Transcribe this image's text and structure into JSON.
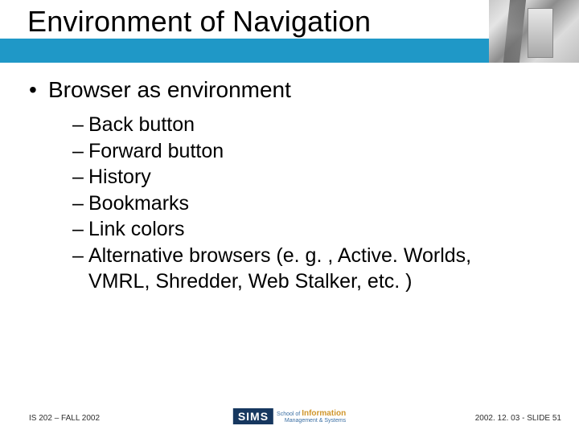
{
  "title": "Environment of Navigation",
  "bullet_main": "Browser as environment",
  "subitems": [
    "Back button",
    "Forward button",
    "History",
    "Bookmarks",
    "Link colors",
    "Alternative browsers (e. g. , Active. Worlds, VMRL, Shredder, Web Stalker, etc. )"
  ],
  "alt_line2": "VMRL, Shredder, Web Stalker, etc. )",
  "alt_line1": "Alternative browsers (e. g. , Active. Worlds,",
  "footer": {
    "left": "IS 202 – FALL 2002",
    "right": "2002. 12. 03 - SLIDE 51",
    "logo_main": "SIMS",
    "logo_top": "School of",
    "logo_info": "Information",
    "logo_mgmt": "Management",
    "logo_sys": "& Systems"
  }
}
